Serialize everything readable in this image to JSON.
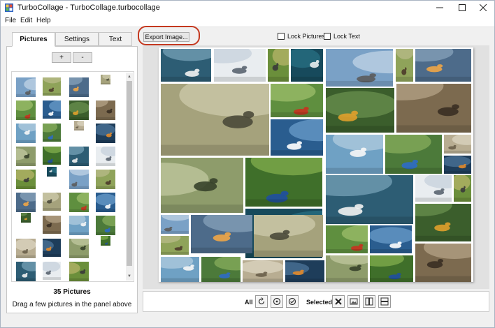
{
  "window": {
    "title": "TurboCollage - TurboCollage.turbocollage"
  },
  "menu": [
    "File",
    "Edit",
    "Help"
  ],
  "left_panel": {
    "tabs": [
      "Pictures",
      "Settings",
      "Text"
    ],
    "active_tab": "Pictures",
    "add_label": "+",
    "remove_label": "-",
    "picture_count": "35 Pictures",
    "hint": "Drag a few pictures in the panel above"
  },
  "toolbar_top": {
    "export_label": "Export Image...",
    "lock_pictures": "Lock Pictures",
    "lock_text": "Lock Text"
  },
  "bottom_toolbar": {
    "all_label": "All",
    "selected_label": "Selected"
  },
  "colors": {
    "highlight": "#c4381f",
    "canvas_bg": "#e1e1e1"
  }
}
